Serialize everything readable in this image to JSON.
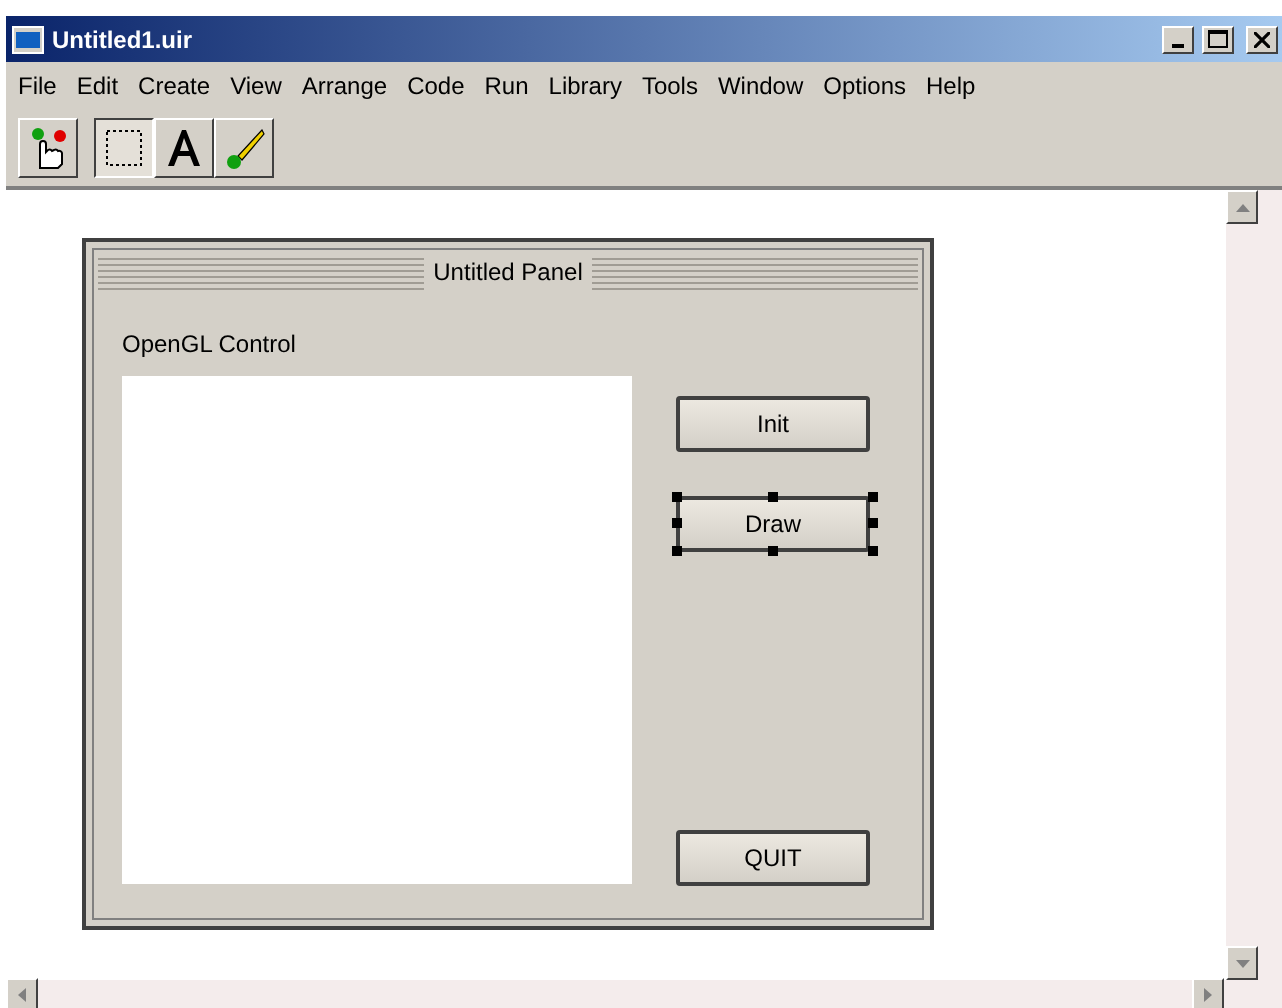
{
  "window": {
    "title": "Untitled1.uir"
  },
  "menu": [
    {
      "label": "File"
    },
    {
      "label": "Edit"
    },
    {
      "label": "Create"
    },
    {
      "label": "View"
    },
    {
      "label": "Arrange"
    },
    {
      "label": "Code"
    },
    {
      "label": "Run"
    },
    {
      "label": "Library"
    },
    {
      "label": "Tools"
    },
    {
      "label": "Window"
    },
    {
      "label": "Options"
    },
    {
      "label": "Help"
    }
  ],
  "tools": [
    {
      "kind": "operate",
      "selected": false
    },
    {
      "kind": "select",
      "selected": true
    },
    {
      "kind": "text",
      "selected": false
    },
    {
      "kind": "color",
      "selected": false
    }
  ],
  "panel": {
    "title": "Untitled Panel",
    "canvas_label": "OpenGL Control",
    "buttons": [
      {
        "label": "Init",
        "selected": false,
        "kind": "top"
      },
      {
        "label": "Draw",
        "selected": true,
        "kind": "top"
      },
      {
        "label": "QUIT",
        "selected": false,
        "kind": "bottom"
      }
    ]
  }
}
